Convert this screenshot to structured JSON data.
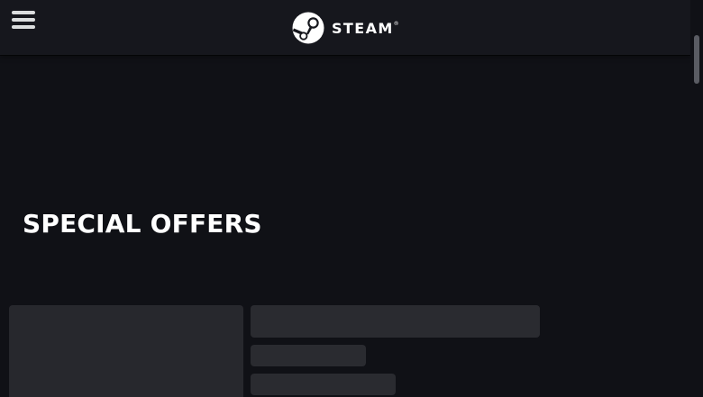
{
  "header": {
    "brand_wordmark": "STEAM",
    "brand_mark": "®",
    "menu_icon": "hamburger-menu-icon",
    "logo_icon": "steam-logo-icon"
  },
  "main": {
    "section_title": "SPECIAL OFFERS"
  },
  "colors": {
    "background": "#101116",
    "header_background": "#16171d",
    "skeleton": "#2a2b30",
    "text": "#ffffff"
  }
}
